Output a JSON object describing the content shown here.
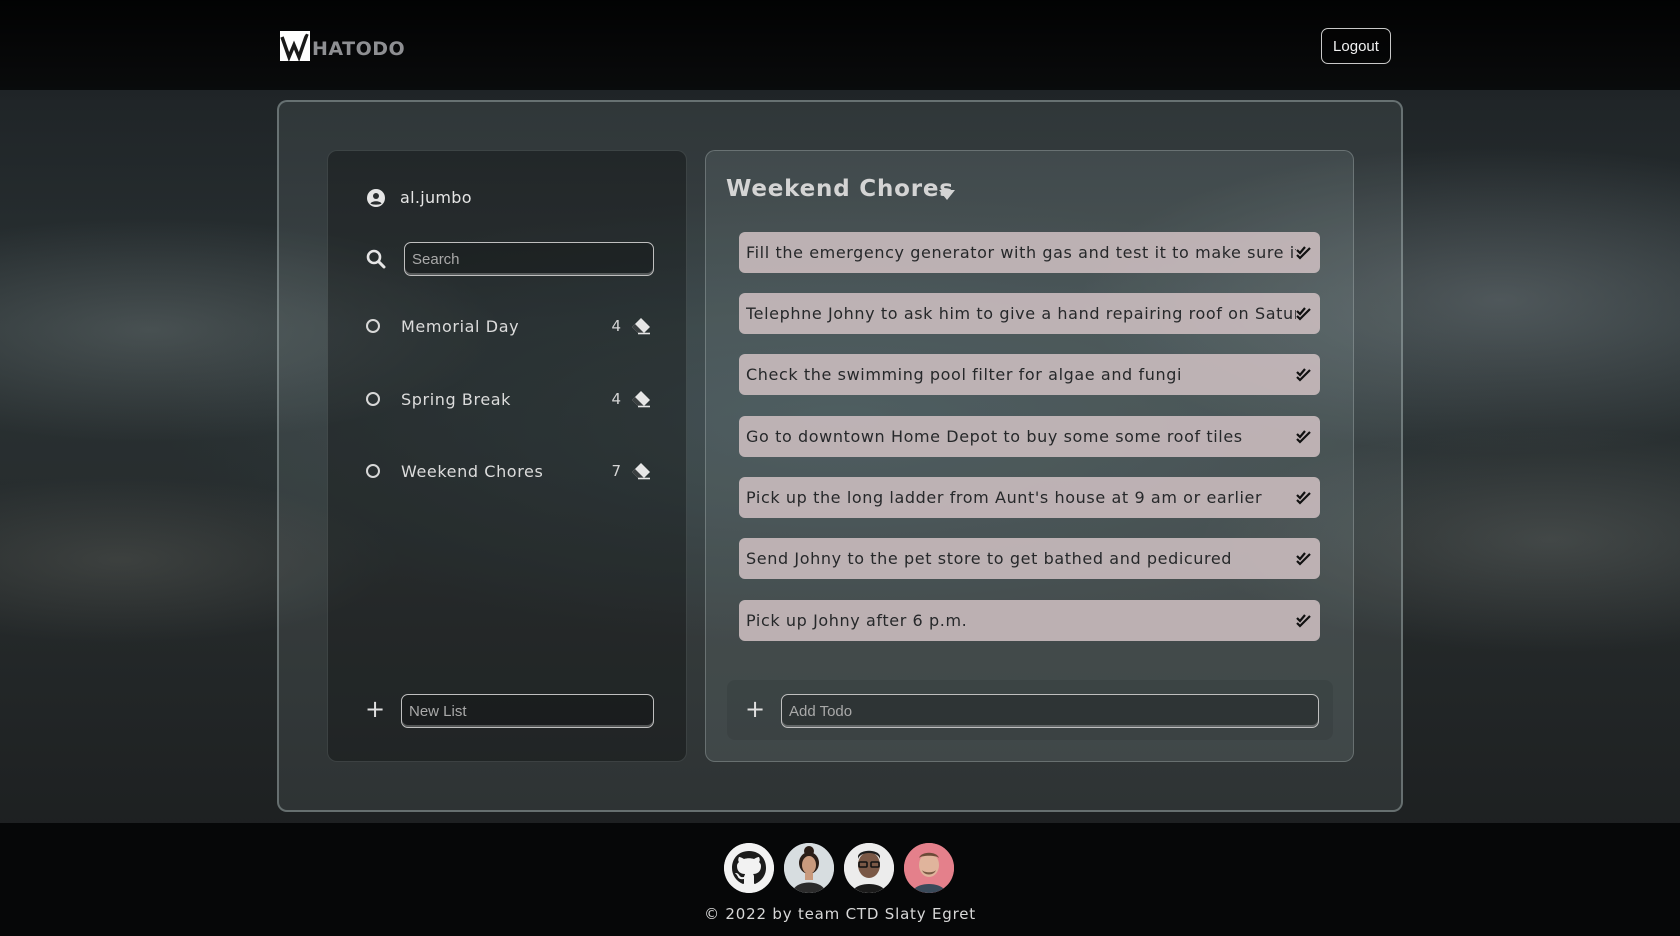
{
  "brand": {
    "logo_text": "HATODO"
  },
  "header": {
    "logout_label": "Logout"
  },
  "user": {
    "name": "al.jumbo"
  },
  "search": {
    "placeholder": "Search"
  },
  "lists": [
    {
      "label": "Memorial Day",
      "count": "4"
    },
    {
      "label": "Spring Break",
      "count": "4"
    },
    {
      "label": "Weekend Chores",
      "count": "7"
    }
  ],
  "new_list": {
    "placeholder": "New List"
  },
  "active_list": {
    "title": "Weekend Chores",
    "todos": [
      "Fill the emergency generator with gas and test it to make sure it works",
      "Telephne Johny to ask him to give a hand repairing roof on Saturday",
      "Check the swimming pool filter for algae and fungi",
      "Go to downtown Home Depot to buy some some roof tiles",
      "Pick up the long ladder from Aunt's house at 9 am or earlier",
      "Send Johny to the pet store to get bathed and pedicured",
      "Pick up Johny after 6 p.m."
    ]
  },
  "add_todo": {
    "placeholder": "Add Todo"
  },
  "footer": {
    "copyright": "© 2022 by team CTD Slaty Egret",
    "links": [
      "github-icon",
      "team-member-avatar-1",
      "team-member-avatar-2",
      "team-member-avatar-3"
    ]
  },
  "colors": {
    "todo_bg": "#cdbec0",
    "accent_text": "#e6e6e6"
  }
}
